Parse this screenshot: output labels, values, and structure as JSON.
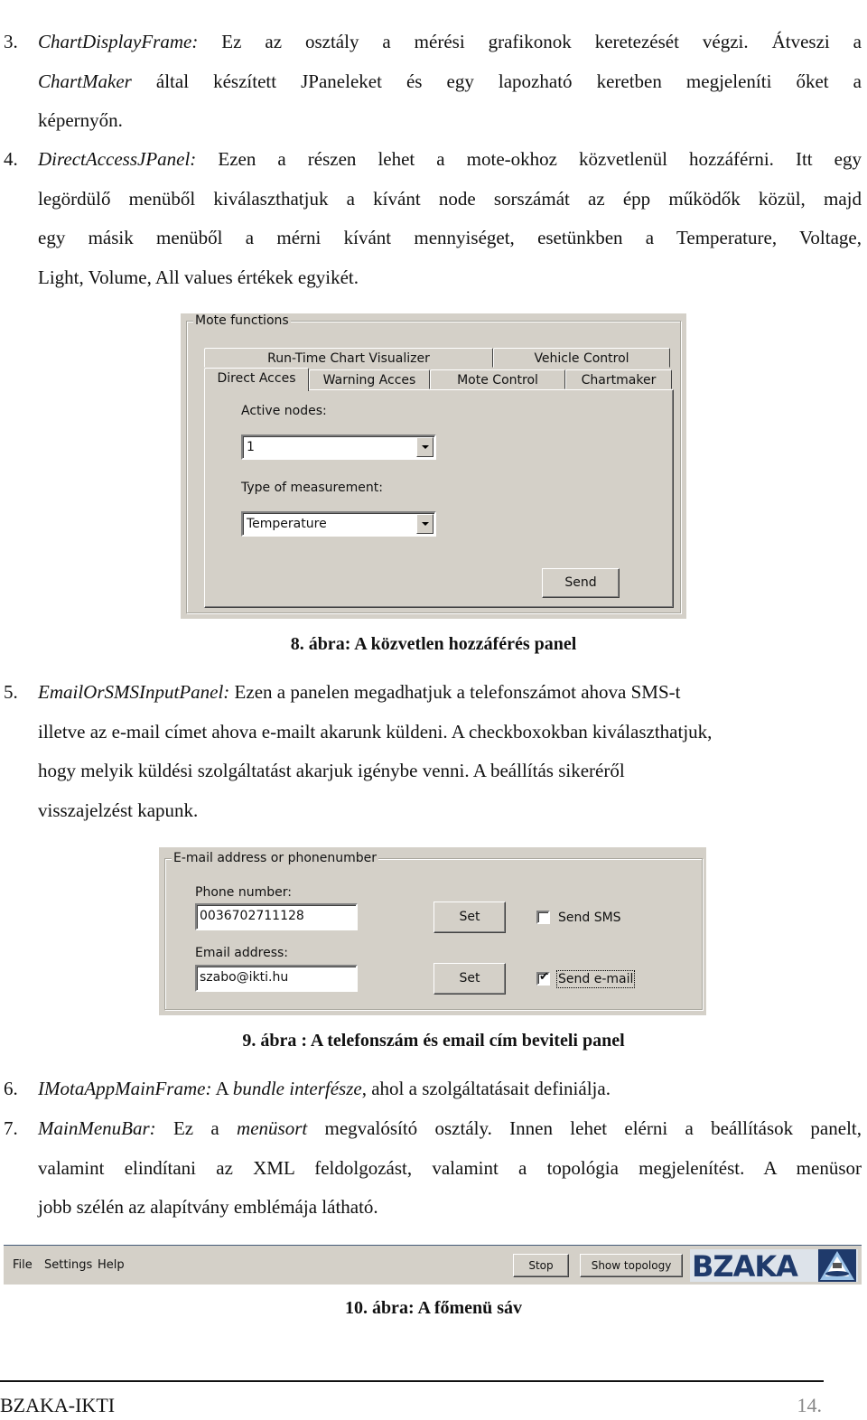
{
  "paragraphs": {
    "p3": {
      "num": "3.",
      "term": "ChartDisplayFrame:",
      "line1_rest": " Ez az osztály a mérési grafikonok keretezését végzi. Átveszi a",
      "line2_term": "ChartMaker",
      "line2_rest": " által készített JPaneleket és egy lapozható keretben megjeleníti őket a",
      "line3": "képernyőn."
    },
    "p4": {
      "num": "4.",
      "term": "DirectAccessJPanel:",
      "line1_rest": " Ezen a részen lehet a mote-okhoz közvetlenül hozzáférni. Itt egy",
      "line2": "legördülő menüből kiválaszthatjuk a kívánt node sorszámát az épp működők közül, majd",
      "line3": "egy másik menüből a mérni kívánt mennyiséget, esetünkben a Temperature, Voltage,",
      "line4": "Light, Volume, All values értékek egyikét."
    },
    "p5": {
      "num": "5.",
      "term": "EmailOrSMSInputPanel:",
      "line1_rest": " Ezen a panelen megadhatjuk a telefonszámot ahova SMS-t",
      "line2": "illetve az e-mail címet ahova e-mailt akarunk küldeni. A checkboxokban kiválaszthatjuk,",
      "line3": "hogy melyik küldési szolgáltatást akarjuk igénybe venni. A beállítás sikeréről",
      "line4": "visszajelzést kapunk."
    },
    "p6": {
      "num": "6.",
      "term": "IMotaAppMainFrame:",
      "mid": " A ",
      "term2": "bundle interfésze",
      "rest": ", ahol a szolgáltatásait definiálja."
    },
    "p7": {
      "num": "7.",
      "term": "MainMenuBar:",
      "mid": " Ez a ",
      "term2": "menüsort",
      "line1_rest": " megvalósító osztály. Innen lehet elérni a beállítások panelt,",
      "line2": "valamint elindítani az XML feldolgozást, valamint a topológia megjelenítést. A menüsor",
      "line3": "jobb szélén az alapítvány emblémája látható."
    }
  },
  "figure8": {
    "caption": "8. ábra: A közvetlen hozzáférés panel",
    "group_title": "Mote functions",
    "tabs_back_row": [
      "Run-Time Chart Visualizer",
      "Vehicle Control"
    ],
    "tabs_front_row": [
      "Direct Acces",
      "Warning Acces",
      "Mote Control",
      "Chartmaker"
    ],
    "selected_tab": "Direct Acces",
    "active_nodes_label": "Active nodes:",
    "active_nodes_value": "1",
    "measurement_label": "Type of measurement:",
    "measurement_value": "Temperature",
    "send_button": "Send"
  },
  "figure9": {
    "caption": "9. ábra : A telefonszám és email cím beviteli panel",
    "group_title": "E-mail address or phonenumber",
    "phone_label": "Phone number:",
    "phone_value": "0036702711128",
    "email_label": "Email address:",
    "email_value": "szabo@ikti.hu",
    "set_button": "Set",
    "send_sms_label": "Send SMS",
    "send_sms_checked": false,
    "send_email_label": "Send e-mail",
    "send_email_checked": true,
    "check_glyph": "✔"
  },
  "figure10": {
    "caption": "10. ábra: A főmenü sáv",
    "menu": [
      "File",
      "Settings",
      "Help"
    ],
    "stop_button": "Stop",
    "topology_button": "Show topology",
    "logo_text": "BZAKA",
    "logo_color": "#1f3a6b"
  },
  "footer": {
    "left": "BZAKA-IKTI",
    "page": "14."
  }
}
